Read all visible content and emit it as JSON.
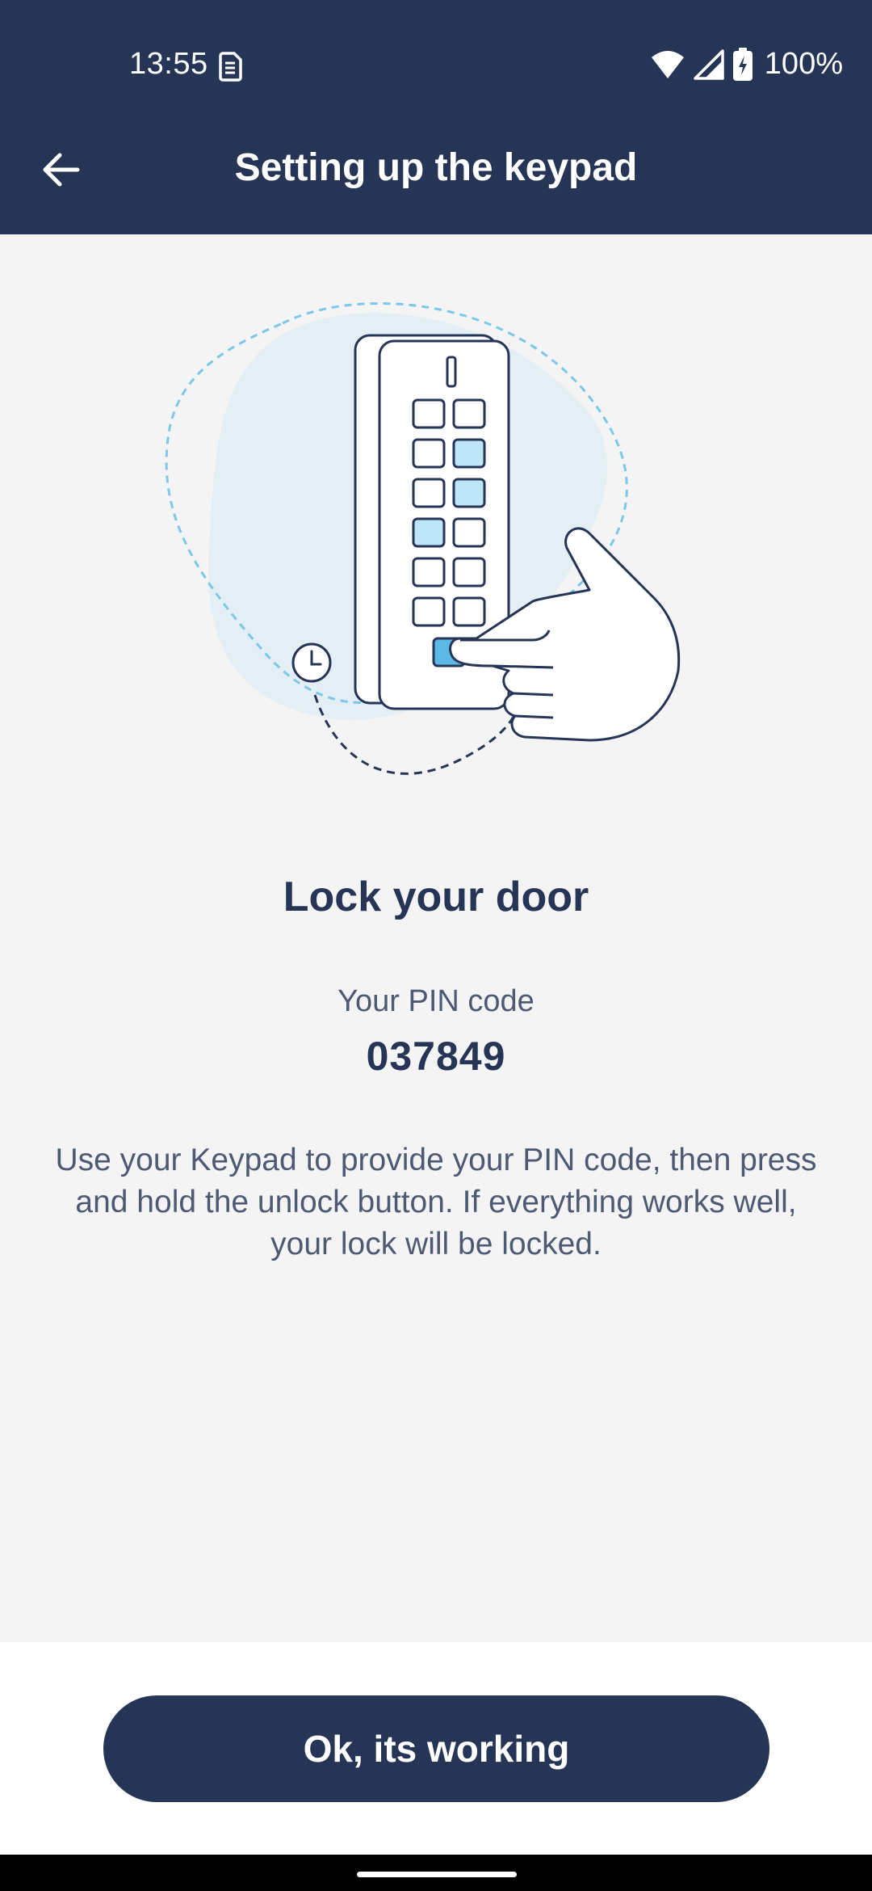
{
  "status_bar": {
    "time": "13:55",
    "battery": "100%",
    "icons": [
      "sim-icon",
      "wifi-icon",
      "signal-icon",
      "battery-charging-icon"
    ]
  },
  "app_bar": {
    "title": "Setting up the keypad",
    "back_icon": "arrow-left-icon"
  },
  "illustration": {
    "subject": "keypad-hand-illustration",
    "colors": {
      "blob": "#e3eef5",
      "dashed": "#7cc8e8",
      "key_highlight": "#bfe6f6",
      "key_active": "#5cb8e4",
      "outline": "#263456"
    }
  },
  "content": {
    "headline": "Lock your door",
    "pin_label": "Your PIN code",
    "pin_value": "037849",
    "instructions": "Use your Keypad to provide your PIN code, then press and hold the unlock button. If everything works well, your lock will be locked."
  },
  "footer": {
    "button_label": "Ok, its working"
  },
  "colors": {
    "primary": "#263456",
    "background": "#f4f4f5",
    "text_muted": "#4e5a73"
  }
}
